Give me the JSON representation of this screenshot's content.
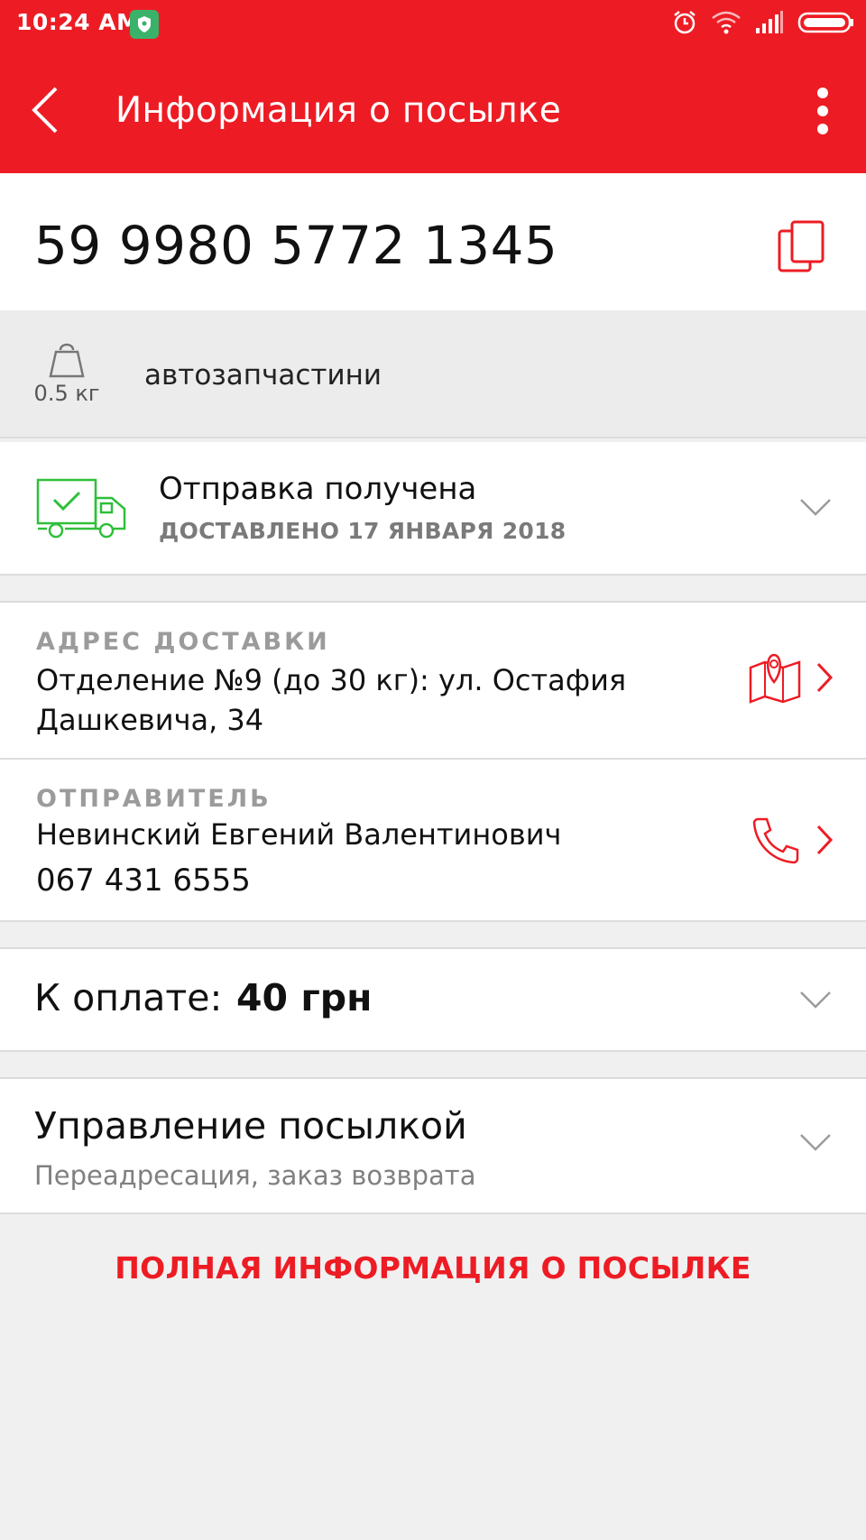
{
  "status_bar": {
    "time": "10:24 AM",
    "battery_icon": "battery-icon",
    "wifi_icon": "wifi-icon",
    "signal_icon": "signal-icon",
    "alarm_icon": "alarm-icon"
  },
  "app_bar": {
    "title": "Информация о посылке",
    "back_icon": "back-arrow-icon",
    "more_icon": "more-vertical-icon"
  },
  "tracking": {
    "number": "59 9980 5772 1345",
    "copy_icon": "copy-icon"
  },
  "parcel": {
    "weight": "0.5 кг",
    "description": "автозапчастини"
  },
  "delivery_status": {
    "title": "Отправка получена",
    "subtitle": "ДОСТАВЛЕНО 17 ЯНВАРЯ 2018"
  },
  "address": {
    "label": "АДРЕС ДОСТАВКИ",
    "value": "Отделение №9 (до 30 кг): ул. Остафия Дашкевича, 34"
  },
  "sender": {
    "label": "ОТПРАВИТЕЛЬ",
    "name": "Невинский Евгений Валентинович",
    "phone": "067 431 6555"
  },
  "payment": {
    "label": "К оплате:",
    "amount": "40 грн"
  },
  "manage": {
    "title": "Управление посылкой",
    "subtitle": "Переадресация, заказ возврата"
  },
  "full_info_link": "ПОЛНАЯ ИНФОРМАЦИЯ О ПОСЫЛКЕ",
  "colors": {
    "brand_red": "#ed1c24",
    "status_green": "#3ab26a",
    "delivered_green": "#2fbf3a"
  }
}
